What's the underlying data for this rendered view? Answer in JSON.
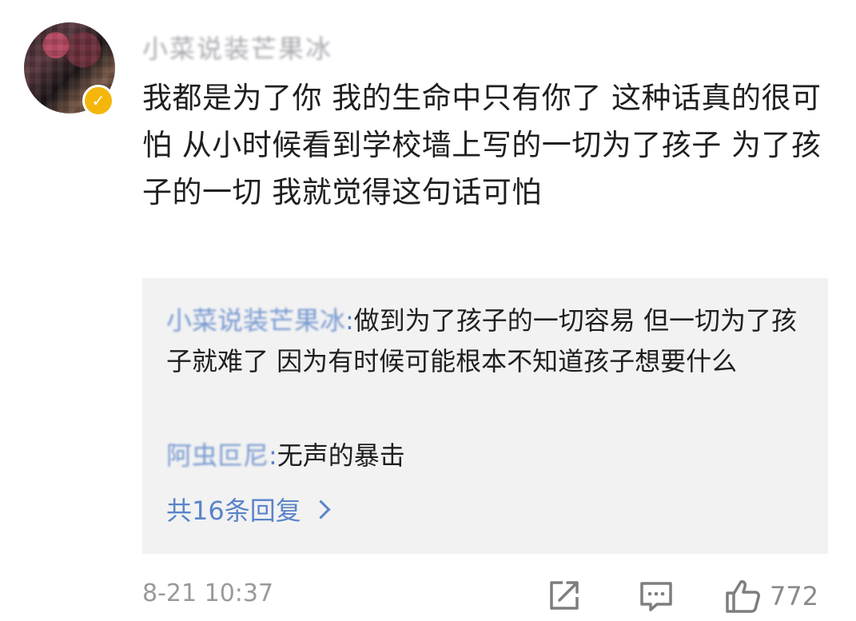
{
  "comment": {
    "username": "小菜说装芒果冰",
    "text": "我都是为了你 我的生命中只有你了 这种话真的很可怕 从小时候看到学校墙上写的一切为了孩子 为了孩子的一切 我就觉得这句话可怕",
    "badge_icon": "vip-badge-icon",
    "badge_color": "#f5b60c"
  },
  "replies": [
    {
      "username": "小菜说装芒果冰",
      "separator": ":",
      "text": "做到为了孩子的一切容易 但一切为了孩子就难了 因为有时候可能根本不知道孩子想要什么"
    },
    {
      "username": "阿虫叵尼",
      "separator": ":",
      "text": "无声的暴击"
    }
  ],
  "more_replies_label": "共16条回复",
  "footer": {
    "timestamp": "8-21 10:37",
    "like_count": "772",
    "share_icon": "share-icon",
    "comment_icon": "comment-icon",
    "like_icon": "thumbs-up-icon"
  },
  "colors": {
    "link": "#5a84c9",
    "reply_background": "#f2f2f2",
    "meta_text": "#9a9a9a"
  }
}
